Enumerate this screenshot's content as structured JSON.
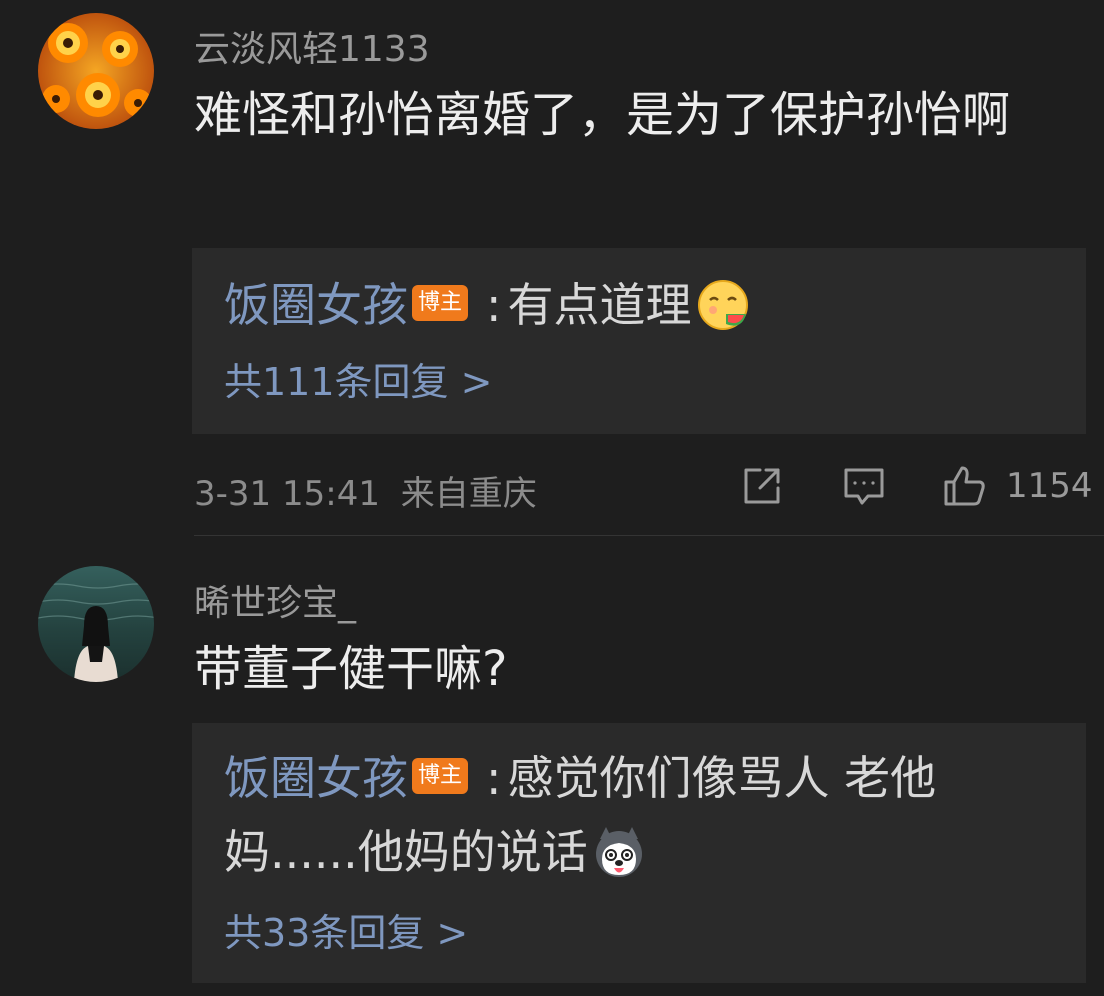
{
  "colors": {
    "background": "#1e1e1e",
    "reply_background": "#2a2a2a",
    "link_blue": "#7f98c0",
    "badge_orange": "#f07a1c"
  },
  "comments": [
    {
      "username": "云淡风轻1133",
      "avatar_icon": "orange-flowers-avatar",
      "text": "难怪和孙怡离婚了，是为了保护孙怡啊",
      "reply": {
        "author": "饭圈女孩",
        "badge": "博主",
        "colon": ":",
        "text": "有点道理",
        "emoji_icon": "eating-watermelon-emoji"
      },
      "reply_count": "共111条回复 >",
      "timestamp": "3-31 15:41",
      "location": "来自重庆",
      "like_count": "1154"
    },
    {
      "username": "晞世珍宝_",
      "avatar_icon": "girl-by-sea-avatar",
      "text": "带董子健干嘛?",
      "reply": {
        "author": "饭圈女孩",
        "badge": "博主",
        "colon": ":",
        "text": "感觉你们像骂人 老他妈......他妈的说话",
        "emoji_icon": "husky-dog-emoji"
      },
      "reply_count": "共33条回复 >"
    }
  ],
  "icons": {
    "share": "share-icon",
    "comment": "comment-icon",
    "like": "thumbs-up-icon"
  }
}
